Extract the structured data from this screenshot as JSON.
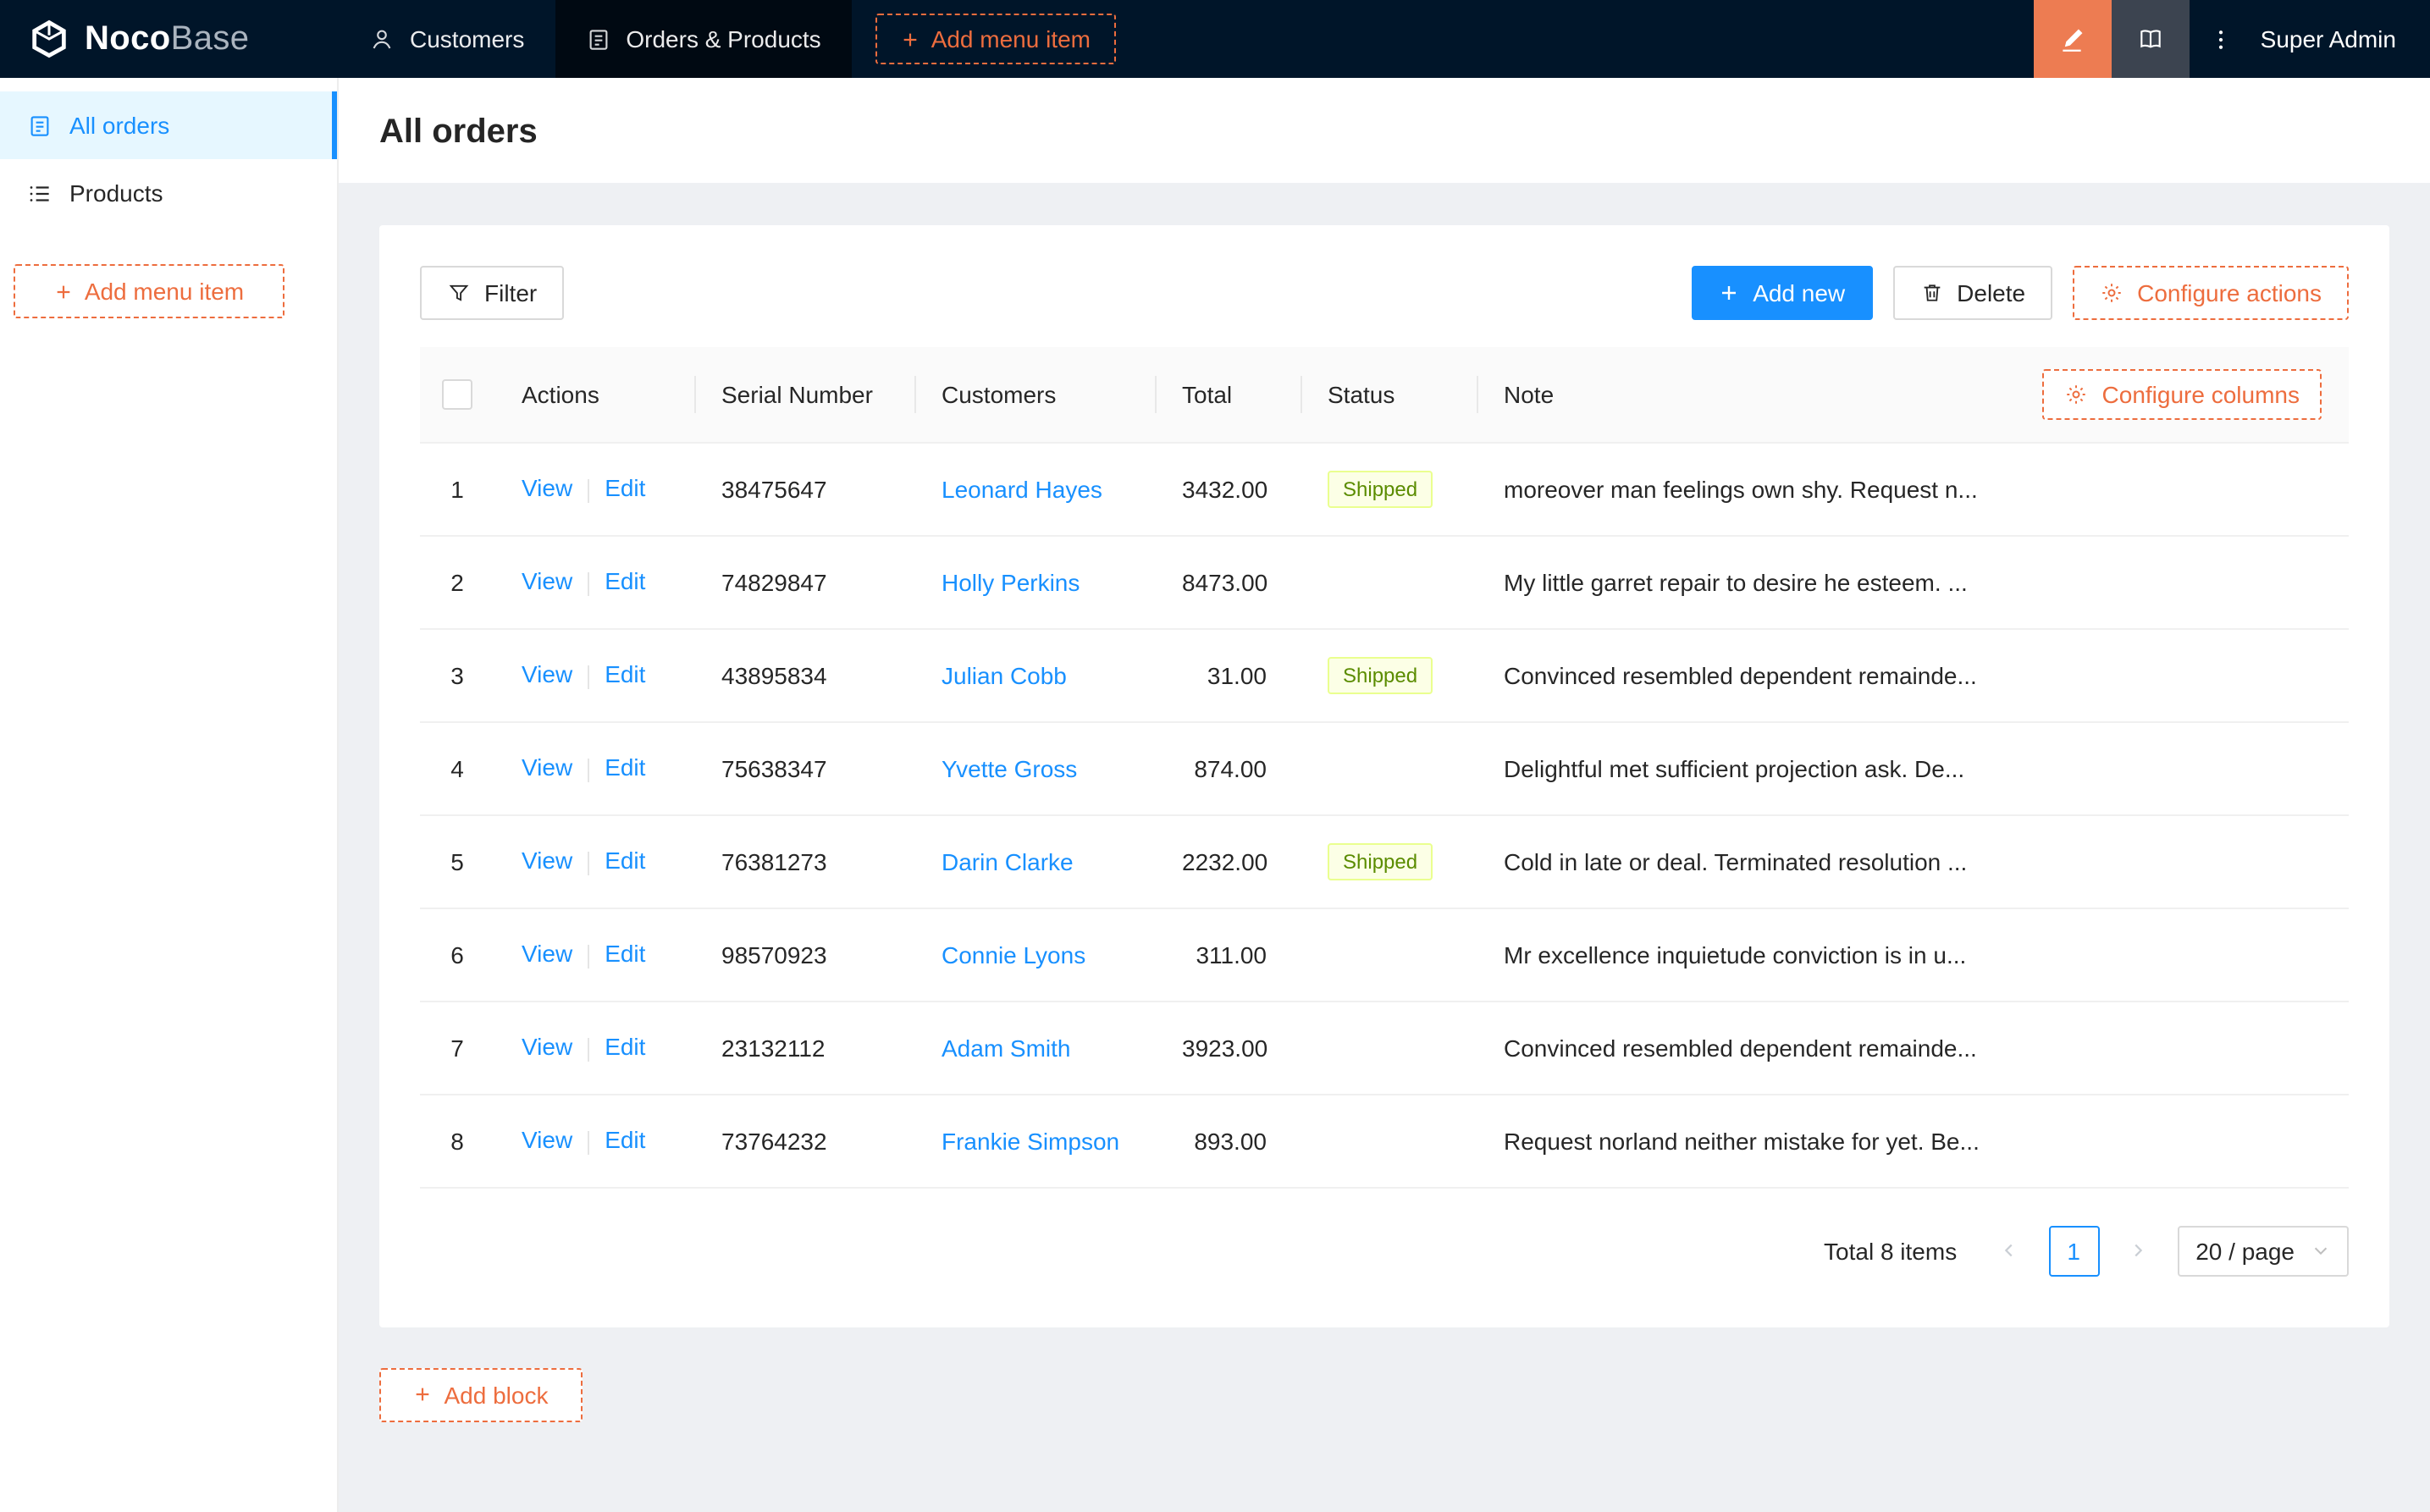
{
  "colors": {
    "navbar_bg": "#001529",
    "navbar_active_tab": "rgba(0,0,0,0.55)",
    "accent_orange": "#ed6d3e",
    "designer_button_orange": "#ed7c52",
    "primary_blue": "#1890ff",
    "sidebar_active_bg": "#e6f7ff",
    "content_bg": "#eef0f3",
    "tag_shipped_bg": "#fcffe6",
    "tag_shipped_border": "#eaff8f",
    "tag_shipped_text": "#5b8c00"
  },
  "icons": {
    "logo": "cube",
    "customers": "person-outline",
    "orders_products": "clipboard-list",
    "add": "plus",
    "ui_editor": "highlighter-pen",
    "api_doc": "book",
    "more": "vertical-ellipsis",
    "all_orders": "file-list",
    "products": "unordered-list",
    "filter": "funnel",
    "delete": "trash",
    "configure": "gear",
    "prev_page": "chevron-left",
    "next_page": "chevron-right",
    "select_open": "chevron-down",
    "select_all": "checkbox"
  },
  "navbar": {
    "logo_primary": "Noco",
    "logo_secondary": "Base",
    "menu": [
      {
        "label": "Customers"
      },
      {
        "label": "Orders & Products"
      }
    ],
    "add_menu_item_label": "Add menu item",
    "user_name": "Super Admin"
  },
  "sidebar": {
    "items": [
      {
        "label": "All orders"
      },
      {
        "label": "Products"
      }
    ],
    "add_menu_item_label": "Add menu item"
  },
  "page": {
    "title": "All orders"
  },
  "toolbar": {
    "filter_label": "Filter",
    "add_new_label": "Add new",
    "delete_label": "Delete",
    "configure_actions_label": "Configure actions"
  },
  "table": {
    "headers": {
      "actions": "Actions",
      "serial_number": "Serial Number",
      "customers": "Customers",
      "total": "Total",
      "status": "Status",
      "note": "Note"
    },
    "configure_columns_label": "Configure columns",
    "view_label": "View",
    "edit_label": "Edit",
    "rows": [
      {
        "index": "1",
        "serial": "38475647",
        "customer": "Leonard Hayes",
        "total": "3432.00",
        "status": "Shipped",
        "note": "moreover man feelings own shy. Request n..."
      },
      {
        "index": "2",
        "serial": "74829847",
        "customer": "Holly Perkins",
        "total": "8473.00",
        "status": "",
        "note": "My little garret repair to desire he esteem. ..."
      },
      {
        "index": "3",
        "serial": "43895834",
        "customer": "Julian Cobb",
        "total": "31.00",
        "status": "Shipped",
        "note": "Convinced resembled dependent remainde..."
      },
      {
        "index": "4",
        "serial": "75638347",
        "customer": "Yvette Gross",
        "total": "874.00",
        "status": "",
        "note": "Delightful met sufficient projection ask. De..."
      },
      {
        "index": "5",
        "serial": "76381273",
        "customer": "Darin Clarke",
        "total": "2232.00",
        "status": "Shipped",
        "note": "Cold in late or deal. Terminated resolution ..."
      },
      {
        "index": "6",
        "serial": "98570923",
        "customer": "Connie Lyons",
        "total": "311.00",
        "status": "",
        "note": "Mr excellence inquietude conviction is in u..."
      },
      {
        "index": "7",
        "serial": "23132112",
        "customer": "Adam Smith",
        "total": "3923.00",
        "status": "",
        "note": "Convinced resembled dependent remainde..."
      },
      {
        "index": "8",
        "serial": "73764232",
        "customer": "Frankie Simpson",
        "total": "893.00",
        "status": "",
        "note": "Request norland neither mistake for yet. Be..."
      }
    ]
  },
  "pagination": {
    "total_label": "Total 8 items",
    "current_page": "1",
    "page_size_label": "20 / page"
  },
  "add_block_label": "Add block"
}
